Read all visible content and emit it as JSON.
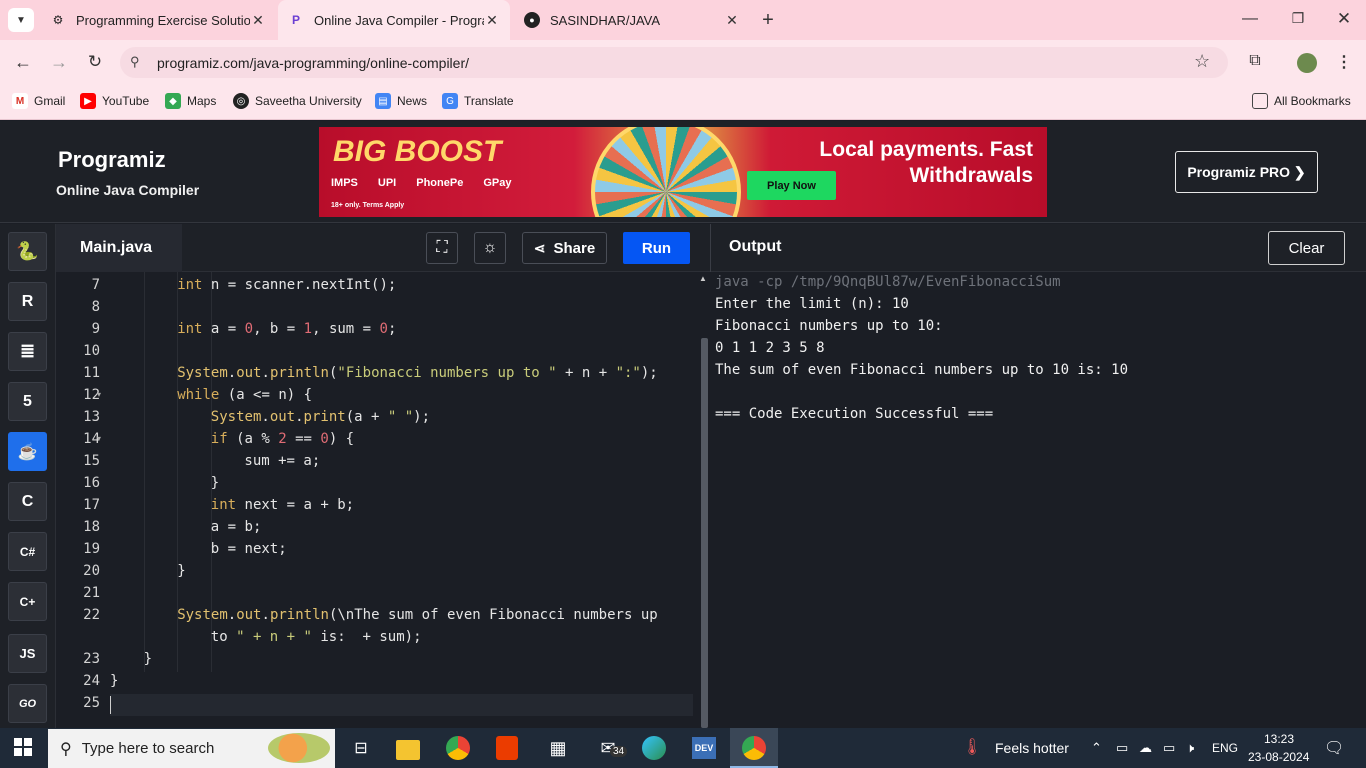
{
  "browser": {
    "tabs": [
      {
        "title": "Programming Exercise Solution",
        "active": false
      },
      {
        "title": "Online Java Compiler - Program",
        "active": true
      },
      {
        "title": "SASINDHAR/JAVA",
        "active": false
      }
    ],
    "url": "programiz.com/java-programming/online-compiler/",
    "bookmarks": [
      "Gmail",
      "YouTube",
      "Maps",
      "Saveetha University",
      "News",
      "Translate"
    ],
    "all_bookmarks": "All Bookmarks"
  },
  "site": {
    "logo": "Programiz",
    "subtitle": "Online Java Compiler",
    "pro_button": "Programiz PRO ❯",
    "ad": {
      "headline": "BIG BOOST",
      "tagline_1": "Local payments. Fast",
      "tagline_2": "Withdrawals",
      "cta": "Play Now",
      "payments": [
        "IMPS",
        "UPI",
        "PhonePe",
        "GPay"
      ],
      "disclaimer": "18+ only. Terms Apply"
    }
  },
  "toolbar": {
    "file_tab": "Main.java",
    "share": "Share",
    "run": "Run",
    "output_label": "Output",
    "clear": "Clear"
  },
  "sidebar": {
    "languages": [
      {
        "name": "Python",
        "label": "",
        "active": false
      },
      {
        "name": "R",
        "label": "R",
        "active": false
      },
      {
        "name": "SQL",
        "label": "",
        "active": false
      },
      {
        "name": "HTML",
        "label": "5",
        "active": false
      },
      {
        "name": "Java",
        "label": "",
        "active": true
      },
      {
        "name": "C",
        "label": "C",
        "active": false
      },
      {
        "name": "C#",
        "label": "C#",
        "active": false
      },
      {
        "name": "C++",
        "label": "C+",
        "active": false
      },
      {
        "name": "JavaScript",
        "label": "JS",
        "active": false
      },
      {
        "name": "Go",
        "label": "GO",
        "active": false
      }
    ]
  },
  "editor": {
    "lines": [
      {
        "n": "7",
        "fold": false,
        "indent": 2,
        "text": "int n = scanner.nextInt();"
      },
      {
        "n": "8",
        "fold": false,
        "indent": 0,
        "text": ""
      },
      {
        "n": "9",
        "fold": false,
        "indent": 2,
        "text": "int a = 0, b = 1, sum = 0;"
      },
      {
        "n": "10",
        "fold": false,
        "indent": 0,
        "text": ""
      },
      {
        "n": "11",
        "fold": false,
        "indent": 2,
        "text": "System.out.println(\"Fibonacci numbers up to \" + n + \":\");"
      },
      {
        "n": "12",
        "fold": true,
        "indent": 2,
        "text": "while (a <= n) {"
      },
      {
        "n": "13",
        "fold": false,
        "indent": 3,
        "text": "System.out.print(a + \" \");"
      },
      {
        "n": "14",
        "fold": true,
        "indent": 3,
        "text": "if (a % 2 == 0) {"
      },
      {
        "n": "15",
        "fold": false,
        "indent": 4,
        "text": "sum += a;"
      },
      {
        "n": "16",
        "fold": false,
        "indent": 3,
        "text": "}"
      },
      {
        "n": "17",
        "fold": false,
        "indent": 3,
        "text": "int next = a + b;"
      },
      {
        "n": "18",
        "fold": false,
        "indent": 3,
        "text": "a = b;"
      },
      {
        "n": "19",
        "fold": false,
        "indent": 3,
        "text": "b = next;"
      },
      {
        "n": "20",
        "fold": false,
        "indent": 2,
        "text": "}"
      },
      {
        "n": "21",
        "fold": false,
        "indent": 0,
        "text": ""
      },
      {
        "n": "22",
        "fold": false,
        "indent": 2,
        "text": "System.out.println(\"\\nThe sum of even Fibonacci numbers up"
      },
      {
        "n": "",
        "fold": false,
        "indent": 3,
        "text": "to \" + n + \" is: \" + sum);"
      },
      {
        "n": "23",
        "fold": false,
        "indent": 1,
        "text": "}"
      },
      {
        "n": "24",
        "fold": false,
        "indent": 0,
        "text": "}"
      },
      {
        "n": "25",
        "fold": false,
        "indent": 0,
        "text": ""
      }
    ]
  },
  "output": {
    "command": "java -cp /tmp/9QnqBUl87w/EvenFibonacciSum",
    "lines": [
      "Enter the limit (n): 10",
      "Fibonacci numbers up to 10:",
      "0 1 1 2 3 5 8",
      "The sum of even Fibonacci numbers up to 10 is: 10",
      "",
      "=== Code Execution Successful ==="
    ]
  },
  "taskbar": {
    "search_placeholder": "Type here to search",
    "weather": "Feels hotter",
    "lang": "ENG",
    "time": "13:23",
    "date": "23-08-2024",
    "mail_badge": "34"
  },
  "colors": {
    "run_button": "#0556f3",
    "java_active": "#1f6feb",
    "tab_bg": "#fcd3dd"
  }
}
